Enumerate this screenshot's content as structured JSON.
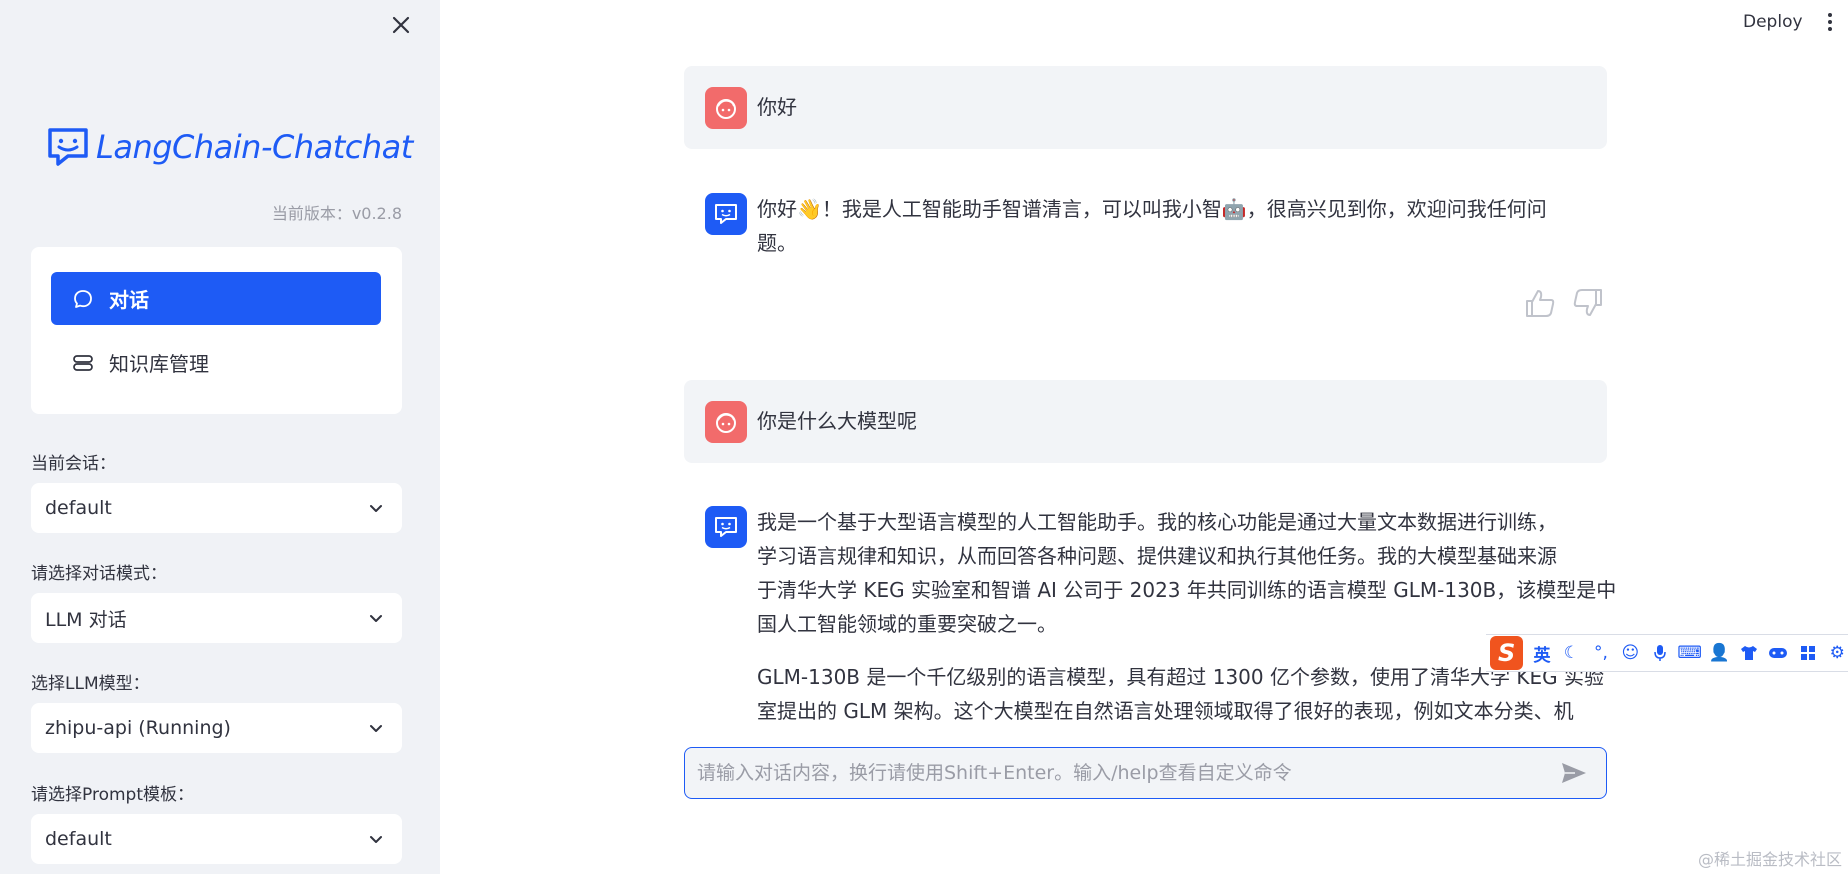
{
  "sidebar": {
    "logo_text": "LangChain-Chatchat",
    "version": "当前版本：v0.2.8",
    "nav": [
      {
        "label": "对话",
        "icon": "chat-bubble-icon"
      },
      {
        "label": "知识库管理",
        "icon": "database-icon"
      }
    ],
    "fields": [
      {
        "label": "当前会话：",
        "value": "default"
      },
      {
        "label": "请选择对话模式：",
        "value": "LLM 对话"
      },
      {
        "label": "选择LLM模型：",
        "value": "zhipu-api (Running)"
      },
      {
        "label": "请选择Prompt模板：",
        "value": "default"
      }
    ]
  },
  "header": {
    "deploy_label": "Deploy"
  },
  "messages": [
    {
      "role": "user",
      "text": "你好"
    },
    {
      "role": "assistant",
      "line1": "你好👋！我是人工智能助手智谱清言，可以叫我小智🤖，很高兴见到你，欢迎问我任何问",
      "line2": "题。"
    },
    {
      "role": "user",
      "text": "你是什么大模型呢"
    },
    {
      "role": "assistant",
      "para1": [
        "我是一个基于大型语言模型的人工智能助手。我的核心功能是通过大量文本数据进行训练，",
        "学习语言规律和知识，从而回答各种问题、提供建议和执行其他任务。我的大模型基础来源",
        "于清华大学 KEG 实验室和智谱 AI 公司于 2023 年共同训练的语言模型 GLM-130B，该模型是中",
        "国人工智能领域的重要突破之一。"
      ],
      "para2": [
        "GLM-130B 是一个千亿级别的语言模型，具有超过 1300 亿个参数，使用了清华大学 KEG 实验",
        "室提出的 GLM 架构。这个大模型在自然语言处理领域取得了很好的表现，例如文本分类、机"
      ]
    }
  ],
  "input": {
    "placeholder": "请输入对话内容，换行请使用Shift+Enter。输入/help查看自定义命令"
  },
  "ime": {
    "logo": "S",
    "lang": "英",
    "items": [
      "moon-icon",
      "punctuation-icon",
      "emoji-icon",
      "mic-icon",
      "keyboard-icon",
      "user-icon",
      "shirt-icon",
      "game-icon",
      "grid-icon",
      "settings-icon"
    ]
  },
  "watermark": "@稀土掘金技术社区",
  "colors": {
    "accent": "#1e5bf5",
    "user_avatar": "#f26b6b",
    "sidebar_bg": "#f0f2f6"
  }
}
